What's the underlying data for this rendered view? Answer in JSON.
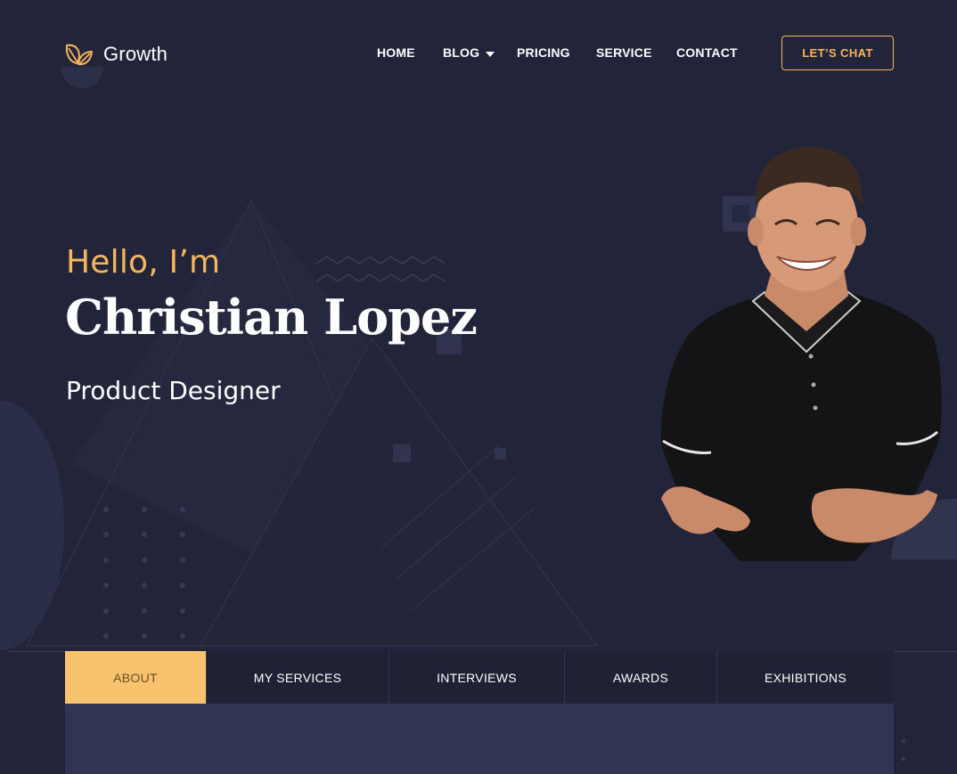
{
  "header": {
    "logo_text": "Growth",
    "nav": [
      {
        "label": "HOME"
      },
      {
        "label": "BLOG"
      },
      {
        "label": "PRICING"
      },
      {
        "label": "SERVICE"
      },
      {
        "label": "CONTACT"
      }
    ],
    "cta_label": "LET’S CHAT"
  },
  "hero": {
    "greeting": "Hello, I’m",
    "name": "Christian Lopez",
    "role": "Product Designer"
  },
  "tabs": [
    {
      "label": "ABOUT",
      "active": true
    },
    {
      "label": "MY SERVICES",
      "active": false
    },
    {
      "label": "INTERVIEWS",
      "active": false
    },
    {
      "label": "AWARDS",
      "active": false
    },
    {
      "label": "EXHIBITIONS",
      "active": false
    }
  ],
  "colors": {
    "background": "#22253a",
    "accent": "#f7b55c",
    "active_tab": "#f9c26f",
    "panel": "#313452"
  }
}
